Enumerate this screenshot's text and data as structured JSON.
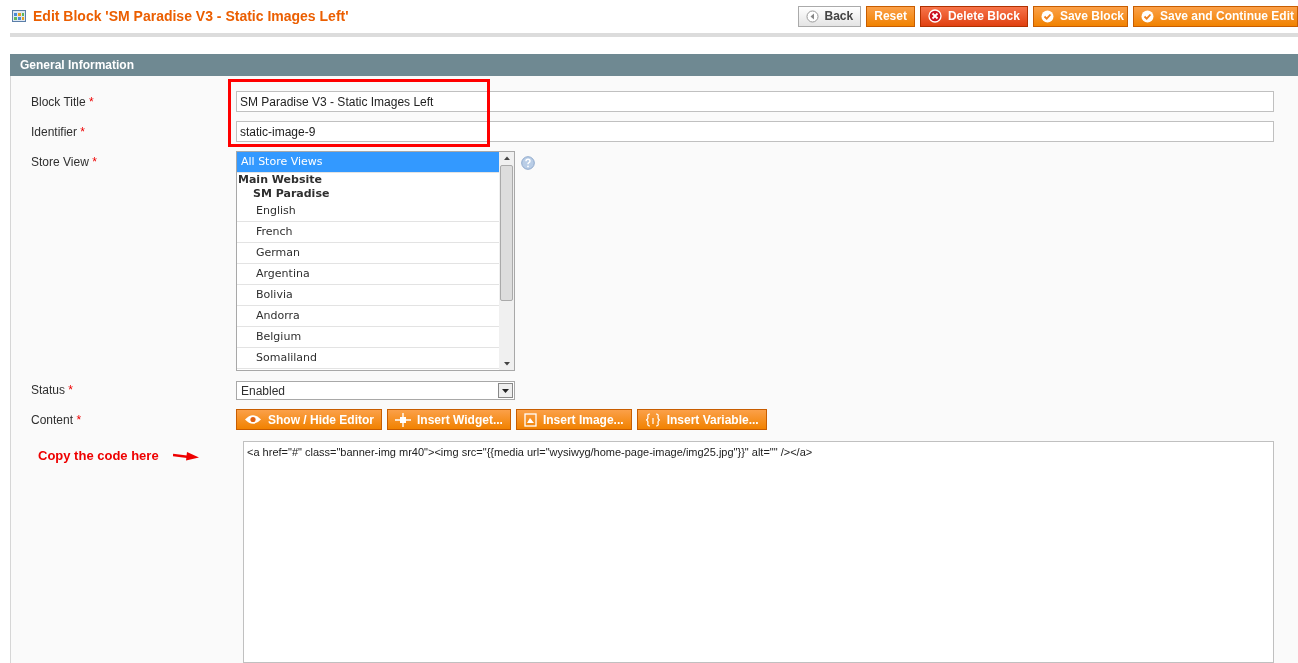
{
  "page_title": "Edit Block 'SM Paradise V3 - Static Images Left'",
  "buttons": [
    {
      "label": "Back",
      "kind": "back"
    },
    {
      "label": "Reset",
      "kind": "plain"
    },
    {
      "label": "Delete Block",
      "kind": "delete"
    },
    {
      "label": "Save Block",
      "kind": "save"
    },
    {
      "label": "Save and Continue Edit",
      "kind": "save"
    }
  ],
  "section_title": "General Information",
  "fields": {
    "block_title": {
      "label": "Block Title",
      "required_mark": "*",
      "value": "SM Paradise V3 - Static Images Left"
    },
    "identifier": {
      "label": "Identifier",
      "required_mark": "*",
      "value": "static-image-9"
    },
    "store_view": {
      "label": "Store View",
      "required_mark": "*",
      "options": [
        {
          "label": "All Store Views",
          "selected": true
        },
        {
          "group": "Main Website",
          "children": [
            {
              "group": "SM Paradise",
              "children": [
                {
                  "label": "English",
                  "selected": false
                },
                {
                  "label": "French",
                  "selected": false
                },
                {
                  "label": "German",
                  "selected": false
                },
                {
                  "label": "Argentina",
                  "selected": false
                },
                {
                  "label": "Bolivia",
                  "selected": false
                },
                {
                  "label": "Andorra",
                  "selected": false
                },
                {
                  "label": "Belgium",
                  "selected": false
                },
                {
                  "label": "Somaliland",
                  "selected": false
                }
              ]
            }
          ]
        }
      ]
    },
    "status": {
      "label": "Status",
      "required_mark": "*",
      "value": "Enabled"
    },
    "content": {
      "label": "Content",
      "required_mark": "*",
      "value": "<a href=\"#\" class=\"banner-img mr40\"><img src=\"{{media url=\"wysiwyg/home-page-image/img25.jpg\"}}\" alt=\"\" /></a>",
      "editor_buttons": [
        {
          "label": "Show / Hide Editor",
          "kind": "eye"
        },
        {
          "label": "Insert Widget...",
          "kind": "widget"
        },
        {
          "label": "Insert Image...",
          "kind": "image"
        },
        {
          "label": "Insert Variable...",
          "kind": "variable"
        }
      ]
    }
  },
  "annotation": {
    "text": "Copy the code here"
  }
}
